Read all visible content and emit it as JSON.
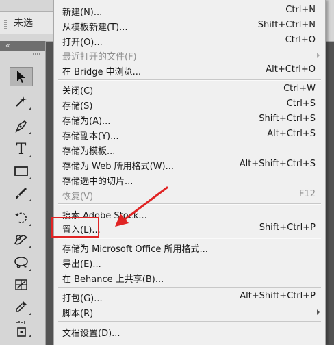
{
  "document_tab": {
    "title": "未选"
  },
  "toolbox": {
    "collapse_label": "«",
    "tools": [
      {
        "name": "move-tool-icon"
      },
      {
        "name": "magic-wand-icon"
      },
      {
        "name": "pen-tool-icon"
      },
      {
        "name": "type-tool-icon",
        "glyph": "T"
      },
      {
        "name": "rectangle-tool-icon"
      },
      {
        "name": "brush-tool-icon"
      },
      {
        "name": "rotate-view-icon"
      },
      {
        "name": "clone-stamp-icon"
      },
      {
        "name": "lasso-icon"
      },
      {
        "name": "slice-tool-icon"
      },
      {
        "name": "eyedropper-icon"
      },
      {
        "name": "count-tool-icon"
      }
    ]
  },
  "menu": {
    "items": [
      {
        "label": "新建(N)...",
        "shortcut": "Ctrl+N"
      },
      {
        "label": "从模板新建(T)...",
        "shortcut": "Shift+Ctrl+N"
      },
      {
        "label": "打开(O)...",
        "shortcut": "Ctrl+O"
      },
      {
        "label": "最近打开的文件(F)",
        "shortcut": ""
      },
      {
        "label": "在 Bridge 中浏览...",
        "shortcut": "Alt+Ctrl+O"
      },
      {
        "label": "关闭(C)",
        "shortcut": "Ctrl+W"
      },
      {
        "label": "存储(S)",
        "shortcut": "Ctrl+S"
      },
      {
        "label": "存储为(A)...",
        "shortcut": "Shift+Ctrl+S"
      },
      {
        "label": "存储副本(Y)...",
        "shortcut": "Alt+Ctrl+S"
      },
      {
        "label": "存储为模板...",
        "shortcut": ""
      },
      {
        "label": "存储为 Web 所用格式(W)...",
        "shortcut": "Alt+Shift+Ctrl+S"
      },
      {
        "label": "存储选中的切片...",
        "shortcut": ""
      },
      {
        "label": "恢复(V)",
        "shortcut": "F12"
      },
      {
        "label": "搜索 Adobe Stock...",
        "shortcut": ""
      },
      {
        "label": "置入(L)...",
        "shortcut": "Shift+Ctrl+P"
      },
      {
        "label": "存储为 Microsoft Office 所用格式...",
        "shortcut": ""
      },
      {
        "label": "导出(E)...",
        "shortcut": ""
      },
      {
        "label": "在 Behance 上共享(B)...",
        "shortcut": ""
      },
      {
        "label": "打包(G)...",
        "shortcut": "Alt+Shift+Ctrl+P"
      },
      {
        "label": "脚本(R)",
        "shortcut": ""
      },
      {
        "label": "文档设置(D)...",
        "shortcut": ""
      }
    ]
  },
  "colors": {
    "menu_background": "#f0f0f0",
    "disabled_text": "#8e8e8e",
    "annotation_red": "#e02424"
  }
}
